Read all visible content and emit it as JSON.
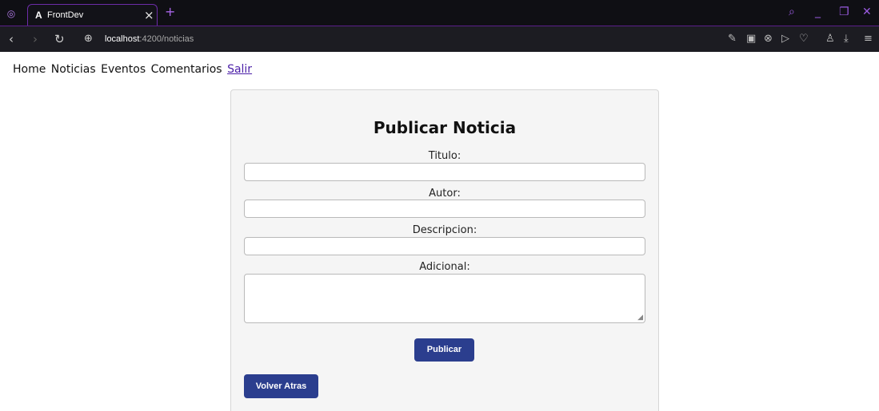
{
  "browser": {
    "tab_title": "FrontDev",
    "tab_close": "×",
    "new_tab": "+",
    "url_host": "localhost",
    "url_path": ":4200/noticias",
    "icons": [
      "opera-icon",
      "back-icon",
      "forward-icon",
      "reload-icon",
      "site-info-icon",
      "edit-icon",
      "snapshot-icon",
      "adblock-icon",
      "send-icon",
      "heart-icon",
      "profile-icon",
      "download-icon",
      "menu-icon",
      "search-icon",
      "minimize-icon",
      "restore-icon",
      "close-icon"
    ]
  },
  "nav": {
    "items": [
      "Home",
      "Noticias",
      "Eventos",
      "Comentarios",
      "Salir"
    ]
  },
  "form": {
    "title": "Publicar Noticia",
    "fields": [
      {
        "label": "Titulo:",
        "value": ""
      },
      {
        "label": "Autor:",
        "value": ""
      },
      {
        "label": "Descripcion:",
        "value": ""
      },
      {
        "label": "Adicional:",
        "value": ""
      }
    ],
    "submit_label": "Publicar",
    "back_label": "Volver Atras"
  },
  "colors": {
    "button": "#2b3e8e",
    "link": "#4b1fa8",
    "accent": "#6c2ca8"
  }
}
